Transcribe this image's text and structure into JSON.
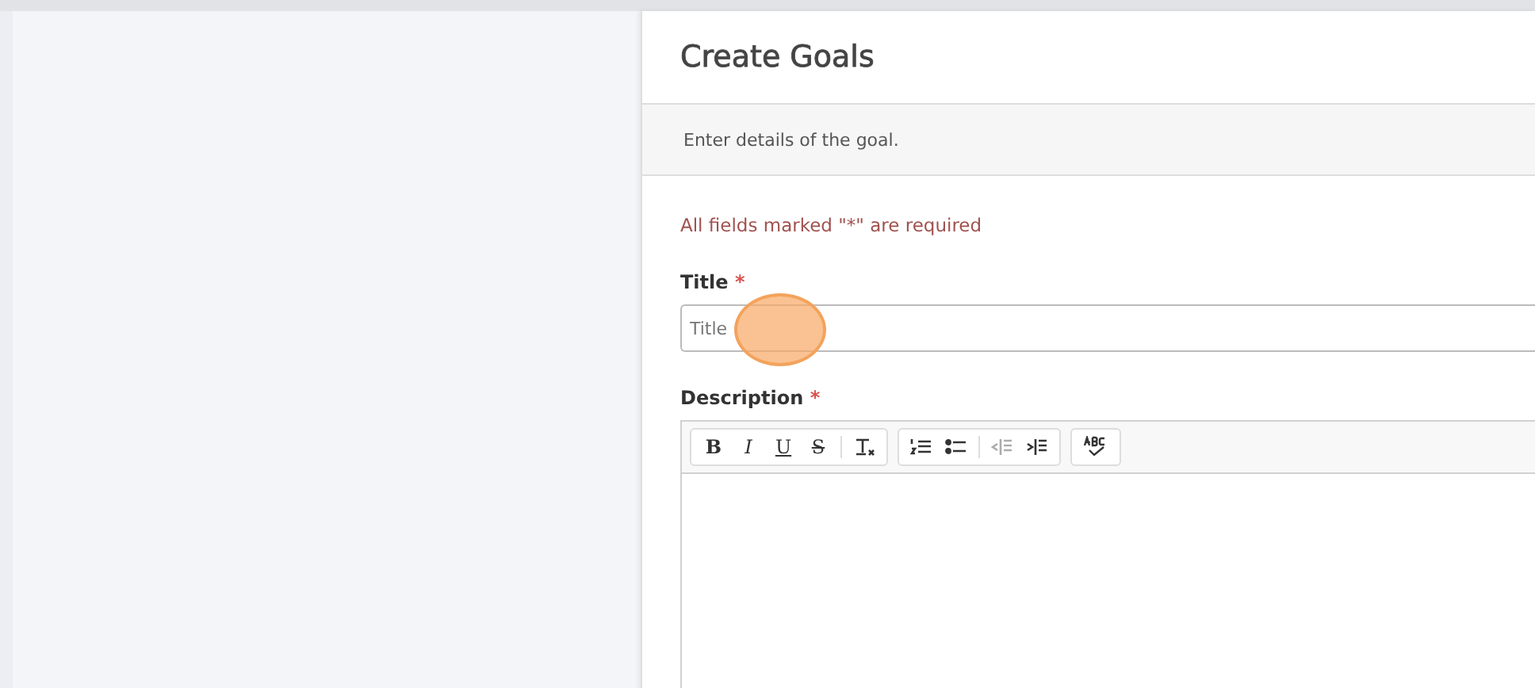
{
  "panel": {
    "title": "Create Goals",
    "subtitle": "Enter details of the goal.",
    "required_note": "All fields marked \"*\" are required"
  },
  "fields": [
    {
      "label": "Title",
      "required_mark": "*",
      "kind": "input",
      "placeholder": "Title",
      "click_marker": true
    },
    {
      "label": "Description",
      "required_mark": "*",
      "kind": "editor",
      "click_marker": false
    }
  ],
  "toolbar_groups": [
    [
      {
        "kind": "bold",
        "label": "B",
        "disabled": false
      },
      {
        "kind": "italic",
        "label": "I",
        "disabled": false
      },
      {
        "kind": "underline",
        "label": "U",
        "disabled": false
      },
      {
        "kind": "strike",
        "label": "S",
        "disabled": false
      },
      {
        "kind": "clear-format",
        "disabled": false
      }
    ],
    [
      {
        "kind": "numbered-list",
        "disabled": false
      },
      {
        "kind": "bulleted-list",
        "disabled": false
      },
      {
        "kind": "outdent",
        "disabled": true
      },
      {
        "kind": "indent",
        "disabled": false
      }
    ],
    [
      {
        "kind": "spellcheck",
        "disabled": false
      }
    ]
  ]
}
